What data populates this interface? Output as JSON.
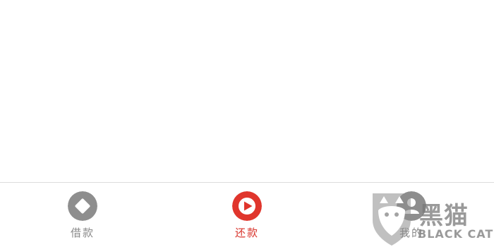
{
  "tabbar": {
    "tabs": [
      {
        "label": "借款",
        "icon": "diamond-circle-icon",
        "active": false
      },
      {
        "label": "还款",
        "icon": "play-circle-icon",
        "active": true
      },
      {
        "label": "我的",
        "icon": "person-icon",
        "active": false
      }
    ]
  },
  "watermark": {
    "cn": "黑猫",
    "en": "BLACK CAT"
  },
  "colors": {
    "active": "#d8332b",
    "inactive": "#8a8a8a",
    "divider": "#dcdcdc"
  }
}
